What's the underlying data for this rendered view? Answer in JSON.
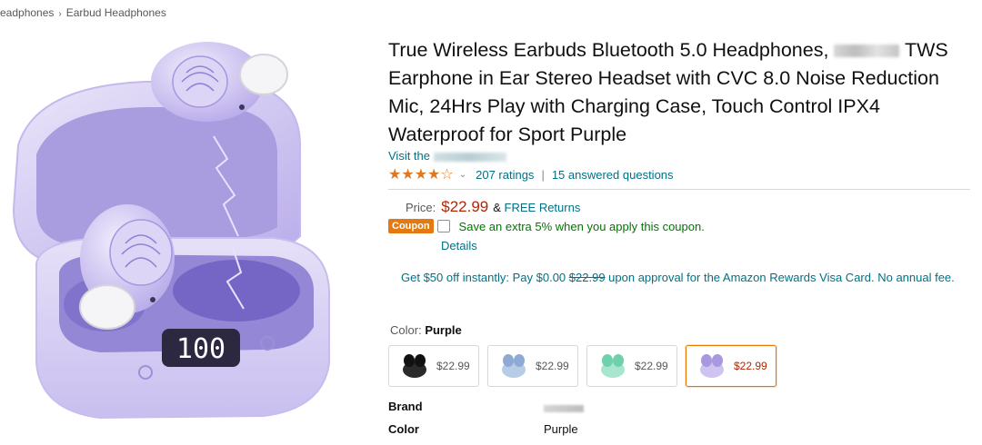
{
  "breadcrumb": [
    "eadphones",
    "Earbud Headphones"
  ],
  "breadcrumb_separator": "›",
  "product": {
    "title_line1": "True Wireless Earbuds Bluetooth 5.0 Headphones,",
    "title_rest": "TWS Earphone in Ear Stereo Headset with CVC 8.0 Noise Reduction Mic, 24Hrs Play with Charging Case, Touch Control IPX4 Waterproof for Sport Purple",
    "store_prefix": "Visit the"
  },
  "rating": {
    "stars": 4,
    "stars_text": "★★★★☆",
    "ratings_count": "207 ratings",
    "separator": "|",
    "answered": "15 answered questions"
  },
  "price": {
    "label": "Price:",
    "value": "$22.99",
    "amp": "&",
    "free_returns": "FREE Returns"
  },
  "coupon": {
    "badge": "Coupon",
    "text": "Save an extra 5% when you apply this coupon.",
    "details": "Details"
  },
  "rewards": {
    "text_before": "Get $50 off instantly: Pay $0.00",
    "struck": "$22.99",
    "text_after": "upon approval for the Amazon Rewards Visa Card. No annual fee."
  },
  "color_selector": {
    "label": "Color:",
    "selected": "Purple",
    "options": [
      {
        "price": "$22.99",
        "color": "#1c1c1c"
      },
      {
        "price": "$22.99",
        "color": "#9ab6d8"
      },
      {
        "price": "$22.99",
        "color": "#7fd6b9"
      },
      {
        "price": "$22.99",
        "color": "#b8a6e6"
      }
    ]
  },
  "specs": [
    {
      "label": "Brand",
      "value": ""
    },
    {
      "label": "Color",
      "value": "Purple"
    }
  ],
  "display_digits": "100",
  "colors": {
    "accent_link": "#007185",
    "price_red": "#b12704",
    "coupon_orange": "#e47911",
    "star_orange": "#de7921",
    "green": "#007600",
    "selected_border": "#e77600"
  }
}
